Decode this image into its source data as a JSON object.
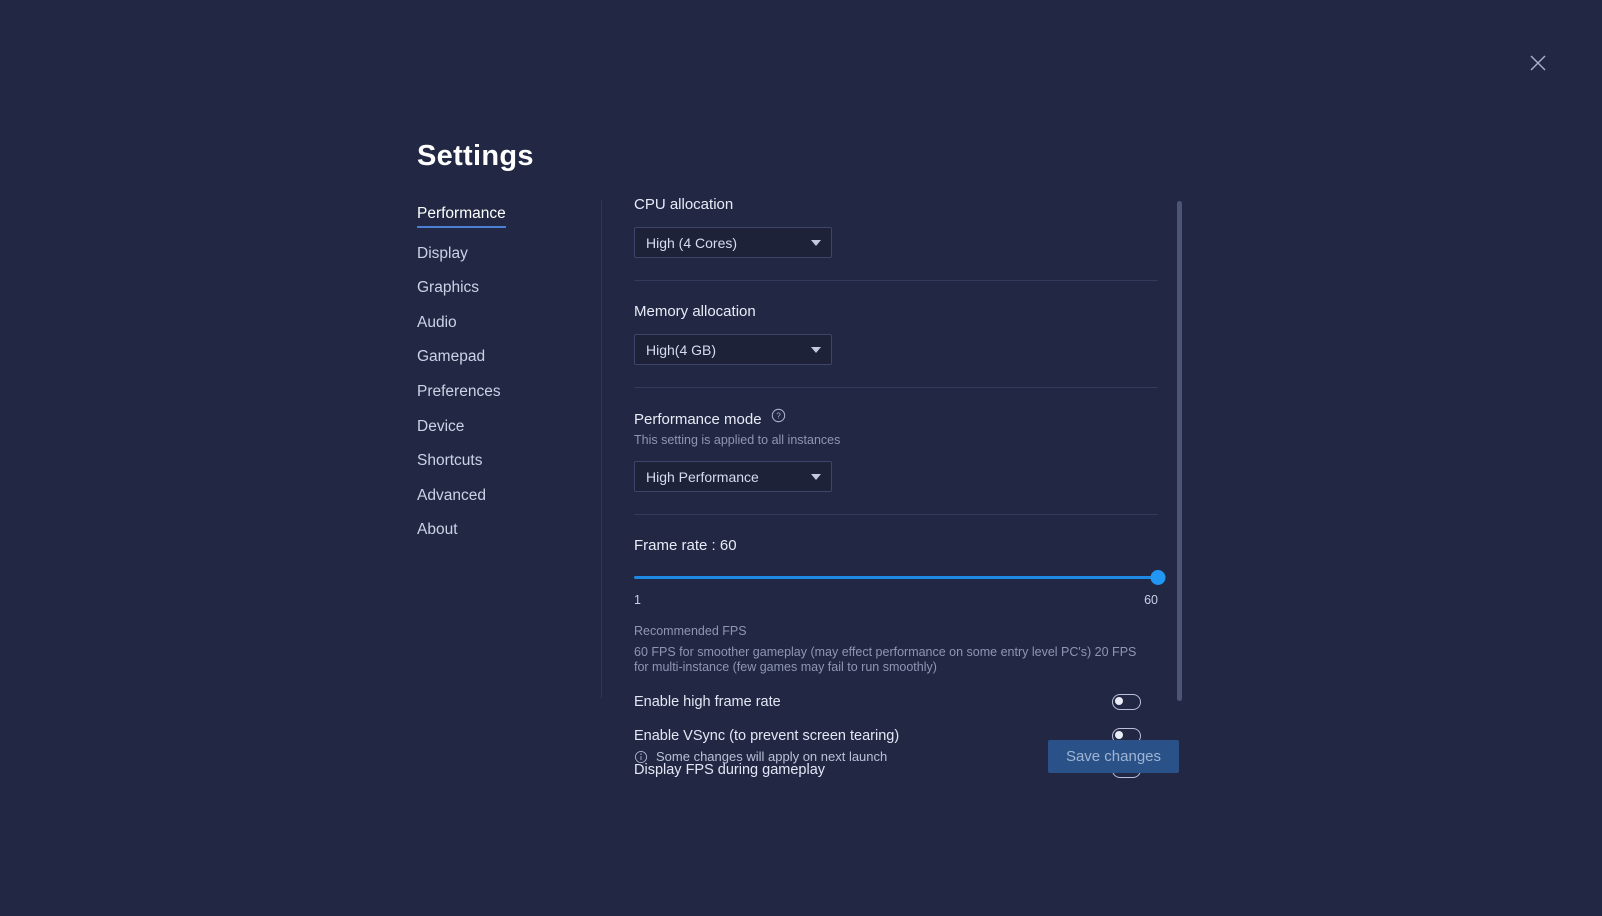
{
  "window": {
    "title": "Settings",
    "close_icon": "close-icon"
  },
  "sidebar": {
    "items": [
      {
        "label": "Performance",
        "active": true
      },
      {
        "label": "Display",
        "active": false
      },
      {
        "label": "Graphics",
        "active": false
      },
      {
        "label": "Audio",
        "active": false
      },
      {
        "label": "Gamepad",
        "active": false
      },
      {
        "label": "Preferences",
        "active": false
      },
      {
        "label": "Device",
        "active": false
      },
      {
        "label": "Shortcuts",
        "active": false
      },
      {
        "label": "Advanced",
        "active": false
      },
      {
        "label": "About",
        "active": false
      }
    ]
  },
  "main": {
    "cpu": {
      "label": "CPU allocation",
      "value": "High (4 Cores)"
    },
    "memory": {
      "label": "Memory allocation",
      "value": "High(4 GB)"
    },
    "performance_mode": {
      "label": "Performance mode",
      "help_icon": "help-circle-icon",
      "sublabel": "This setting is applied to all instances",
      "value": "High Performance"
    },
    "frame_rate": {
      "label": "Frame rate : 60",
      "value": 60,
      "min": 1,
      "max": 60,
      "min_label": "1",
      "max_label": "60",
      "percent": 100,
      "recommended_title": "Recommended FPS",
      "recommended_body": "60 FPS for smoother gameplay (may effect performance on some entry level PC's) 20 FPS for multi-instance (few games may fail to run smoothly)"
    },
    "toggles": [
      {
        "label": "Enable high frame rate",
        "on": false
      },
      {
        "label": "Enable VSync (to prevent screen tearing)",
        "on": false
      },
      {
        "label": "Display FPS during gameplay",
        "on": false
      }
    ]
  },
  "footer": {
    "info_icon": "info-circle-icon",
    "note": "Some changes will apply on next launch",
    "save_label": "Save changes"
  },
  "colors": {
    "background": "#222843",
    "accent_blue": "#2196f3",
    "save_button": "#2b5288",
    "divider": "#333b5c",
    "scrollbar": "#4d5576"
  }
}
